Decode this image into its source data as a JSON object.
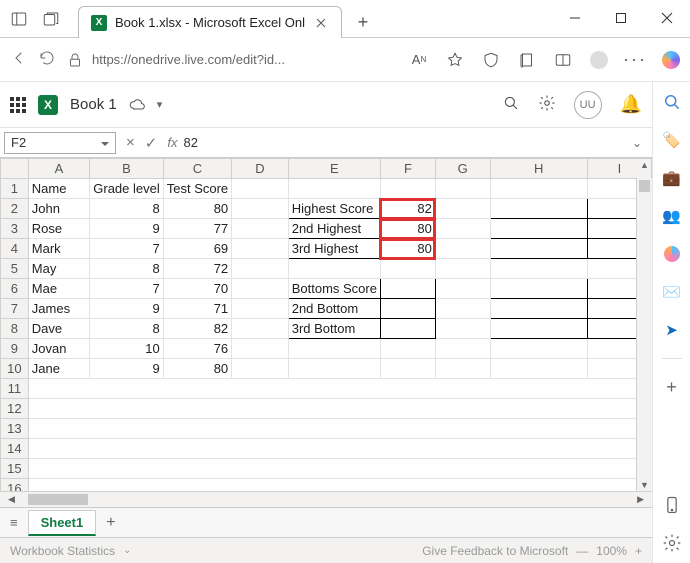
{
  "browser": {
    "tab_title": "Book 1.xlsx - Microsoft Excel Onl",
    "url": "https://onedrive.live.com/edit?id..."
  },
  "app_header": {
    "doc_name": "Book 1",
    "avatar": "UU"
  },
  "formula_bar": {
    "cell_ref": "F2",
    "fx_label": "fx",
    "value": "82"
  },
  "columns": [
    "A",
    "B",
    "C",
    "D",
    "E",
    "F",
    "G",
    "H",
    "I"
  ],
  "data": {
    "headers": {
      "A": "Name",
      "B": "Grade level",
      "C": "Test Score"
    },
    "rows": [
      {
        "A": "John",
        "B": 8,
        "C": 80
      },
      {
        "A": "Rose",
        "B": 9,
        "C": 77
      },
      {
        "A": "Mark",
        "B": 7,
        "C": 69
      },
      {
        "A": "May",
        "B": 8,
        "C": 72
      },
      {
        "A": "Mae",
        "B": 7,
        "C": 70
      },
      {
        "A": "James",
        "B": 9,
        "C": 71
      },
      {
        "A": "Dave",
        "B": 8,
        "C": 82
      },
      {
        "A": "Jovan",
        "B": 10,
        "C": 76
      },
      {
        "A": "Jane",
        "B": 9,
        "C": 80
      }
    ],
    "highest_block": [
      {
        "label": "Highest Score",
        "value": 82
      },
      {
        "label": "2nd Highest",
        "value": 80
      },
      {
        "label": "3rd Highest",
        "value": 80
      }
    ],
    "bottom_block": [
      {
        "label": "Bottoms Score"
      },
      {
        "label": "2nd Bottom"
      },
      {
        "label": "3rd Bottom"
      }
    ]
  },
  "sheet_tabs": {
    "active": "Sheet1"
  },
  "status": {
    "stats": "Workbook Statistics",
    "feedback": "Give Feedback to Microsoft",
    "zoom": "100%"
  }
}
